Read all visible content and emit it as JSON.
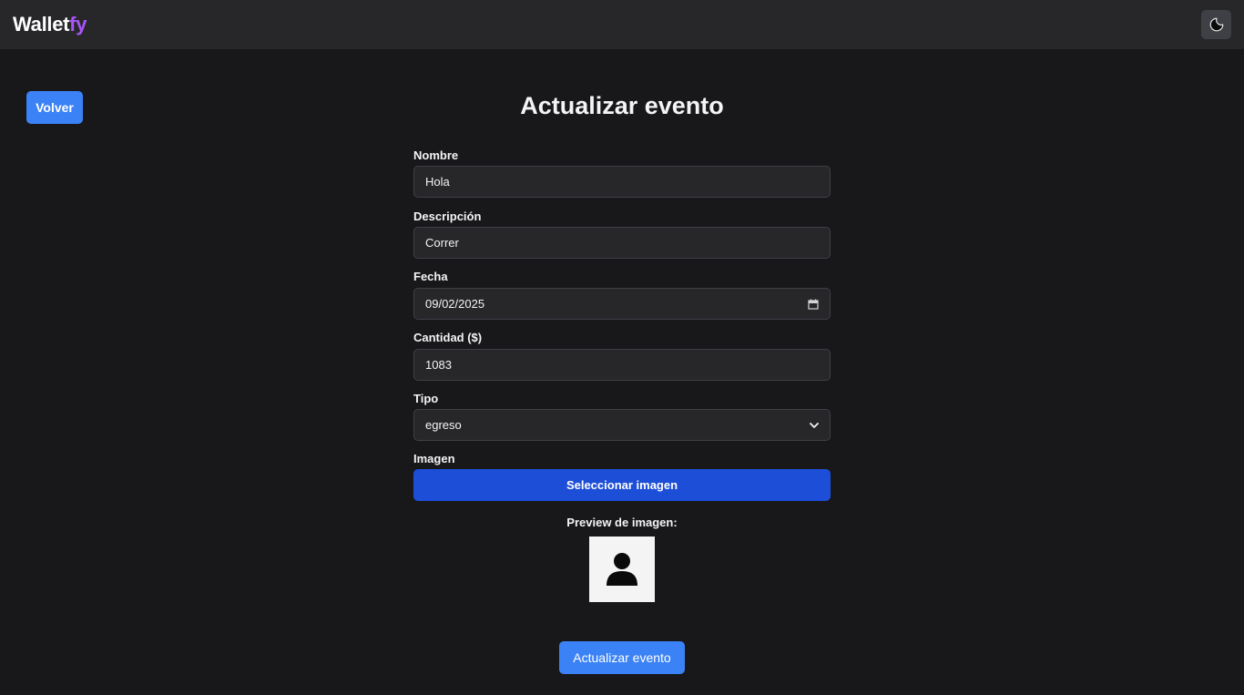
{
  "app": {
    "brand_part1": "Wallet",
    "brand_part2": "fy"
  },
  "nav": {
    "theme_icon": "moon-icon"
  },
  "back_button": "Volver",
  "page_title": "Actualizar evento",
  "form": {
    "nombre": {
      "label": "Nombre",
      "value": "Hola"
    },
    "descripcion": {
      "label": "Descripción",
      "value": "Correr"
    },
    "fecha": {
      "label": "Fecha",
      "value": "09/02/2025",
      "icon": "calendar-icon"
    },
    "cantidad": {
      "label": "Cantidad ($)",
      "value": "1083"
    },
    "tipo": {
      "label": "Tipo",
      "value": "egreso",
      "icon": "chevron-down-icon"
    },
    "imagen": {
      "label": "Imagen",
      "button": "Seleccionar imagen"
    },
    "preview": {
      "label": "Preview de imagen:",
      "icon": "user-placeholder-icon"
    },
    "submit": "Actualizar evento"
  },
  "colors": {
    "background": "#18181b",
    "navbar": "#27272a",
    "accent_blue": "#3b82f6",
    "select_button": "#1d4ed8",
    "brand_purple": "#a855f7"
  }
}
